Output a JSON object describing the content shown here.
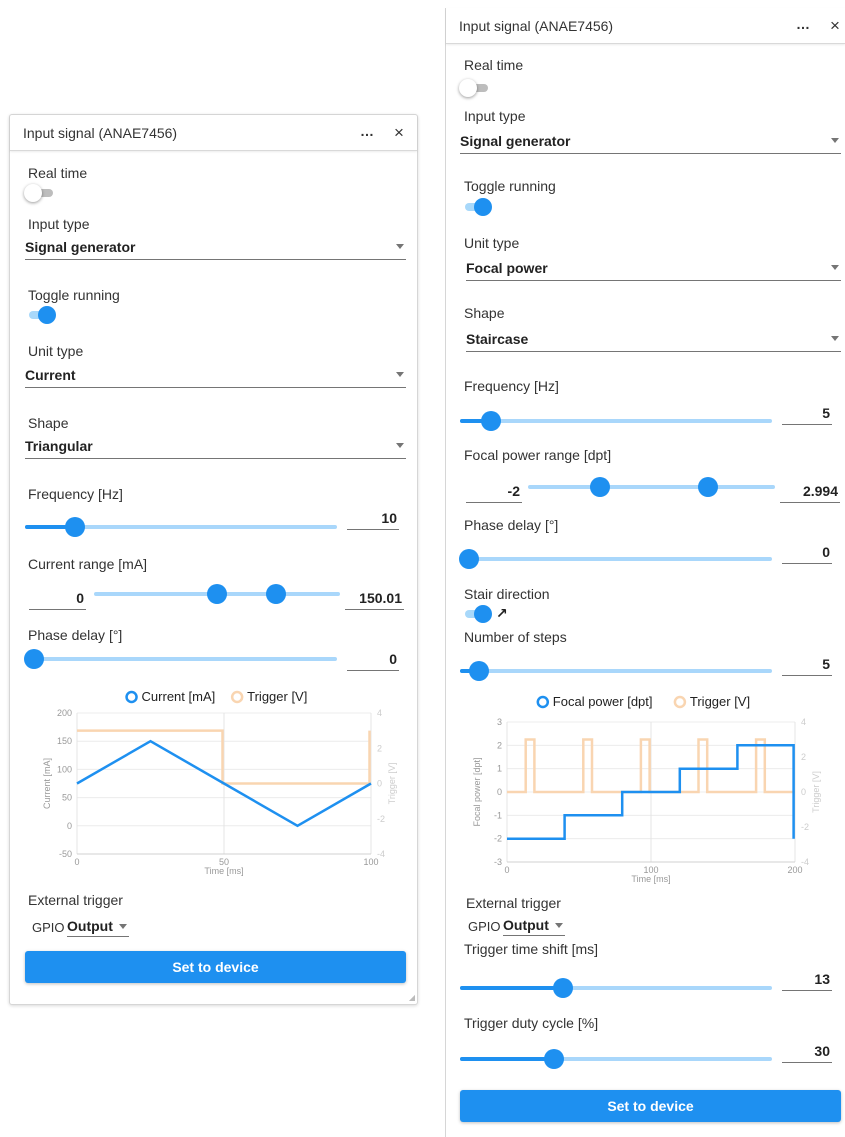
{
  "colors": {
    "accent": "#1e90f0",
    "trigger": "#f9d5b1",
    "track": "#a9d7fb"
  },
  "panelA": {
    "title": "Input signal (ANAE7456)",
    "more_icon": "…",
    "close_icon": "×",
    "real_time_label": "Real time",
    "real_time_on": false,
    "input_type_label": "Input type",
    "input_type_value": "Signal generator",
    "toggle_running_label": "Toggle running",
    "toggle_running_on": true,
    "unit_type_label": "Unit type",
    "unit_type_value": "Current",
    "shape_label": "Shape",
    "shape_value": "Triangular",
    "frequency_label": "Frequency [Hz]",
    "frequency_value": "10",
    "frequency_slider": 0.16,
    "range_label": "Current range [mA]",
    "range_min": "0",
    "range_max": "150.01",
    "range_slider": [
      0.5,
      0.74
    ],
    "phase_label": "Phase delay [°]",
    "phase_value": "0",
    "phase_slider": 0.0,
    "external_trigger_label": "External trigger",
    "gpio_label": "GPIO",
    "gpio_value": "Output",
    "set_button": "Set to device",
    "chart_data": {
      "type": "line",
      "series": [
        {
          "name": "Current [mA]",
          "axis": "left",
          "x": [
            0,
            25,
            50,
            75,
            100
          ],
          "y": [
            75,
            150,
            75,
            0,
            75
          ]
        },
        {
          "name": "Trigger [V]",
          "axis": "right",
          "x": [
            0,
            49.5,
            49.5,
            99.5,
            99.5
          ],
          "y": [
            3,
            3,
            0,
            0,
            3
          ]
        }
      ],
      "xlabel": "Time [ms]",
      "ylabel": "Current [mA]",
      "y2label": "Trigger [V]",
      "xlim": [
        0,
        100
      ],
      "ylim": [
        -50,
        200
      ],
      "y2lim": [
        -4,
        4
      ],
      "xticks": [
        "0",
        "50",
        "100"
      ],
      "yticks": [
        "-50",
        "0",
        "50",
        "100",
        "150",
        "200"
      ],
      "y2ticks": [
        "-4",
        "-2",
        "0",
        "2",
        "4"
      ],
      "legend": "top",
      "grid": true
    }
  },
  "panelB": {
    "title": "Input signal (ANAE7456)",
    "more_icon": "…",
    "close_icon": "×",
    "real_time_label": "Real time",
    "real_time_on": false,
    "input_type_label": "Input type",
    "input_type_value": "Signal generator",
    "toggle_running_label": "Toggle running",
    "toggle_running_on": true,
    "unit_type_label": "Unit type",
    "unit_type_value": "Focal power",
    "shape_label": "Shape",
    "shape_value": "Staircase",
    "frequency_label": "Frequency [Hz]",
    "frequency_value": "5",
    "frequency_slider": 0.1,
    "range_label": "Focal power range [dpt]",
    "range_min": "-2",
    "range_max": "2.994",
    "range_slider": [
      0.29,
      0.73
    ],
    "phase_label": "Phase delay [°]",
    "phase_value": "0",
    "phase_slider": 0.0,
    "stair_direction_label": "Stair direction",
    "stair_direction_on": true,
    "stair_direction_icon": "↗",
    "steps_label": "Number of steps",
    "steps_value": "5",
    "steps_slider": 0.06,
    "external_trigger_label": "External trigger",
    "gpio_label": "GPIO",
    "gpio_value": "Output",
    "shift_label": "Trigger time shift [ms]",
    "shift_value": "13",
    "shift_slider": 0.33,
    "duty_label": "Trigger duty cycle [%]",
    "duty_value": "30",
    "duty_slider": 0.3,
    "set_button": "Set to device",
    "chart_data": {
      "type": "line",
      "series": [
        {
          "name": "Focal power [dpt]",
          "axis": "left",
          "x": [
            0,
            40,
            40,
            80,
            80,
            120,
            120,
            160,
            160,
            199,
            199
          ],
          "y": [
            -2,
            -2,
            -1,
            -1,
            0,
            0,
            1,
            1,
            2,
            2,
            -2
          ]
        },
        {
          "name": "Trigger [V]",
          "axis": "right",
          "x": [
            0,
            13,
            13,
            19,
            19,
            53,
            53,
            59,
            59,
            93,
            93,
            99,
            99,
            133,
            133,
            139,
            139,
            173,
            173,
            179,
            179,
            200
          ],
          "y": [
            0,
            0,
            3,
            3,
            0,
            0,
            3,
            3,
            0,
            0,
            3,
            3,
            0,
            0,
            3,
            3,
            0,
            0,
            3,
            3,
            0,
            0
          ]
        }
      ],
      "xlabel": "Time [ms]",
      "ylabel": "Focal power [dpt]",
      "y2label": "Trigger [V]",
      "xlim": [
        0,
        200
      ],
      "ylim": [
        -3,
        3
      ],
      "y2lim": [
        -4,
        4
      ],
      "xticks": [
        "0",
        "100",
        "200"
      ],
      "yticks": [
        "-3",
        "-2",
        "-1",
        "0",
        "1",
        "2",
        "3"
      ],
      "y2ticks": [
        "-4",
        "-2",
        "0",
        "2",
        "4"
      ],
      "legend": "top",
      "grid": true
    }
  }
}
